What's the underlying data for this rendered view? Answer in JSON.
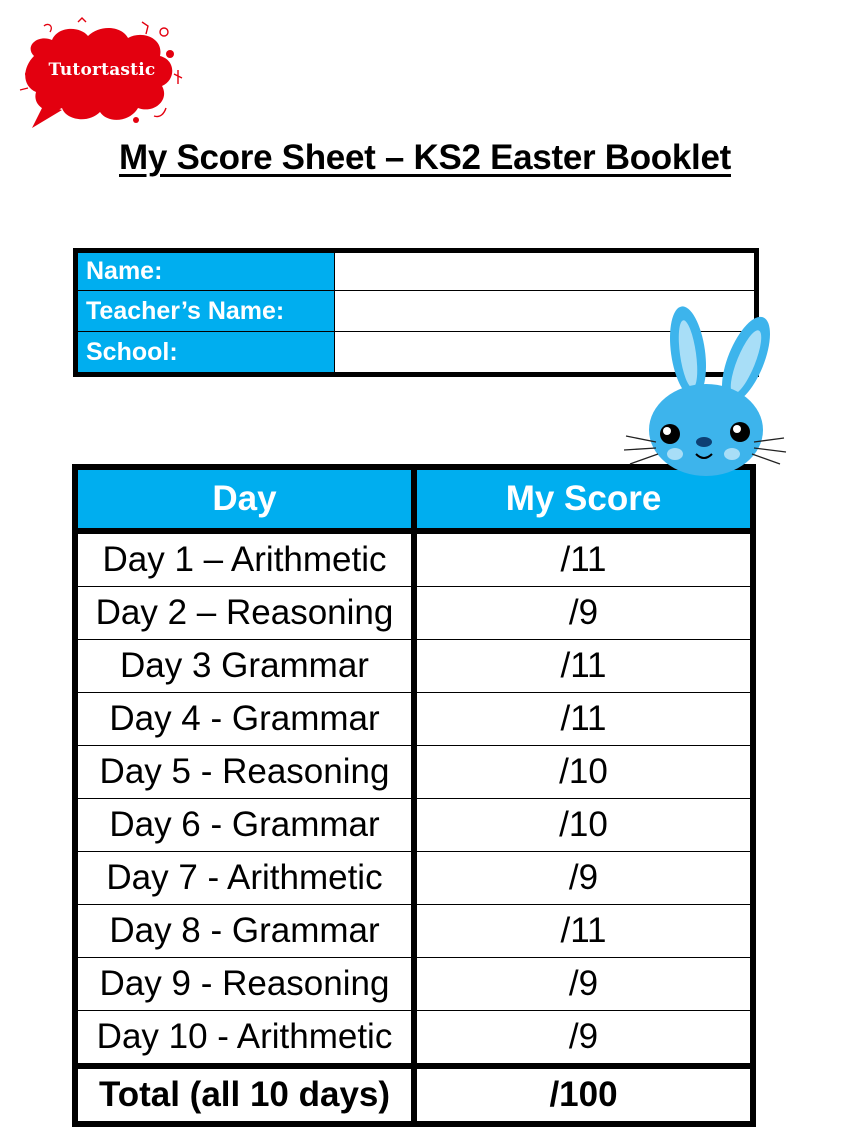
{
  "logo": {
    "text": "Tutortastic",
    "icon": "red-splat-logo",
    "color": "#e3000f"
  },
  "title": "My Score Sheet – KS2 Easter Booklet",
  "info_table": {
    "rows": [
      {
        "label": "Name:",
        "value": ""
      },
      {
        "label": "Teacher’s Name:",
        "value": ""
      },
      {
        "label": "School:",
        "value": ""
      }
    ],
    "label_bg": "#00aeef"
  },
  "score_table": {
    "headers": [
      "Day",
      "My Score"
    ],
    "rows": [
      {
        "day": "Day 1 – Arithmetic",
        "score": "/11"
      },
      {
        "day": "Day 2 – Reasoning",
        "score": "/9"
      },
      {
        "day": "Day 3  Grammar",
        "score": "/11"
      },
      {
        "day": "Day 4 - Grammar",
        "score": "/11"
      },
      {
        "day": "Day 5 - Reasoning",
        "score": "/10"
      },
      {
        "day": "Day 6 - Grammar",
        "score": "/10"
      },
      {
        "day": "Day 7 - Arithmetic",
        "score": "/9"
      },
      {
        "day": "Day 8 - Grammar",
        "score": "/11"
      },
      {
        "day": "Day 9 - Reasoning",
        "score": "/9"
      },
      {
        "day": "Day 10 - Arithmetic",
        "score": "/9"
      }
    ],
    "total": {
      "day": "Total (all 10 days)",
      "score": "/100"
    },
    "header_bg": "#00aeef"
  },
  "decoration": {
    "icon": "easter-bunny-icon",
    "color": "#3db4ec"
  }
}
